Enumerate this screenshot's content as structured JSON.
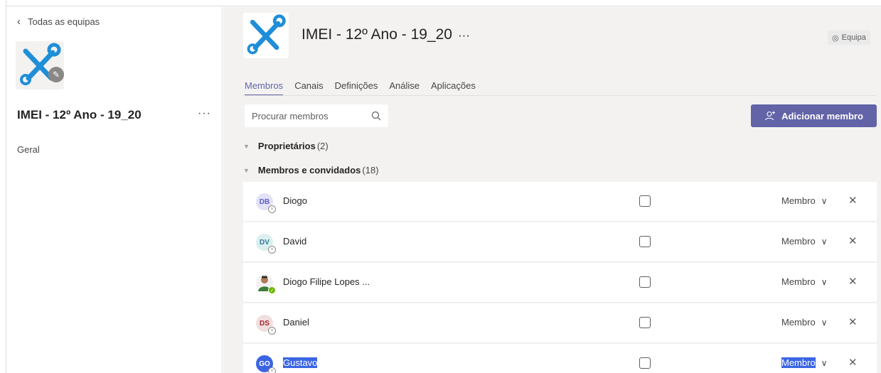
{
  "sidebar": {
    "back_label": "Todas as equipas",
    "team_name": "IMEI - 12º Ano - 19_20",
    "more_label": "···",
    "channels": [
      {
        "label": "Geral"
      }
    ]
  },
  "header": {
    "title": "IMEI - 12º Ano - 19_20",
    "more_label": "···",
    "visibility_label": "Equipa"
  },
  "tabs": [
    {
      "label": "Membros",
      "active": true
    },
    {
      "label": "Canais"
    },
    {
      "label": "Definições"
    },
    {
      "label": "Análise"
    },
    {
      "label": "Aplicações"
    }
  ],
  "search": {
    "placeholder": "Procurar membros"
  },
  "add_member_label": "Adicionar membro",
  "groups": {
    "owners": {
      "label": "Proprietários",
      "count": "(2)"
    },
    "members": {
      "label": "Membros e convidados",
      "count": "(18)"
    }
  },
  "members": [
    {
      "initials": "DB",
      "name": "Diogo",
      "role": "Membro",
      "avatar_bg": "#e3e1f7",
      "avatar_fg": "#5b5fc7"
    },
    {
      "initials": "DV",
      "name": "David",
      "role": "Membro",
      "avatar_bg": "#dcefef",
      "avatar_fg": "#2d7d9a"
    },
    {
      "initials": "",
      "name": "Diogo Filipe Lopes ...",
      "role": "Membro",
      "photo": true,
      "status": "available"
    },
    {
      "initials": "DS",
      "name": "Daniel",
      "role": "Membro",
      "avatar_bg": "#f1dede",
      "avatar_fg": "#a4262c"
    },
    {
      "initials": "GO",
      "name": "Gustavo",
      "role": "Membro",
      "avatar_bg": "#3a65e3",
      "avatar_fg": "#ffffff",
      "selected": true
    }
  ],
  "colors": {
    "accent": "#6264a7",
    "background": "#f3f2f1"
  }
}
